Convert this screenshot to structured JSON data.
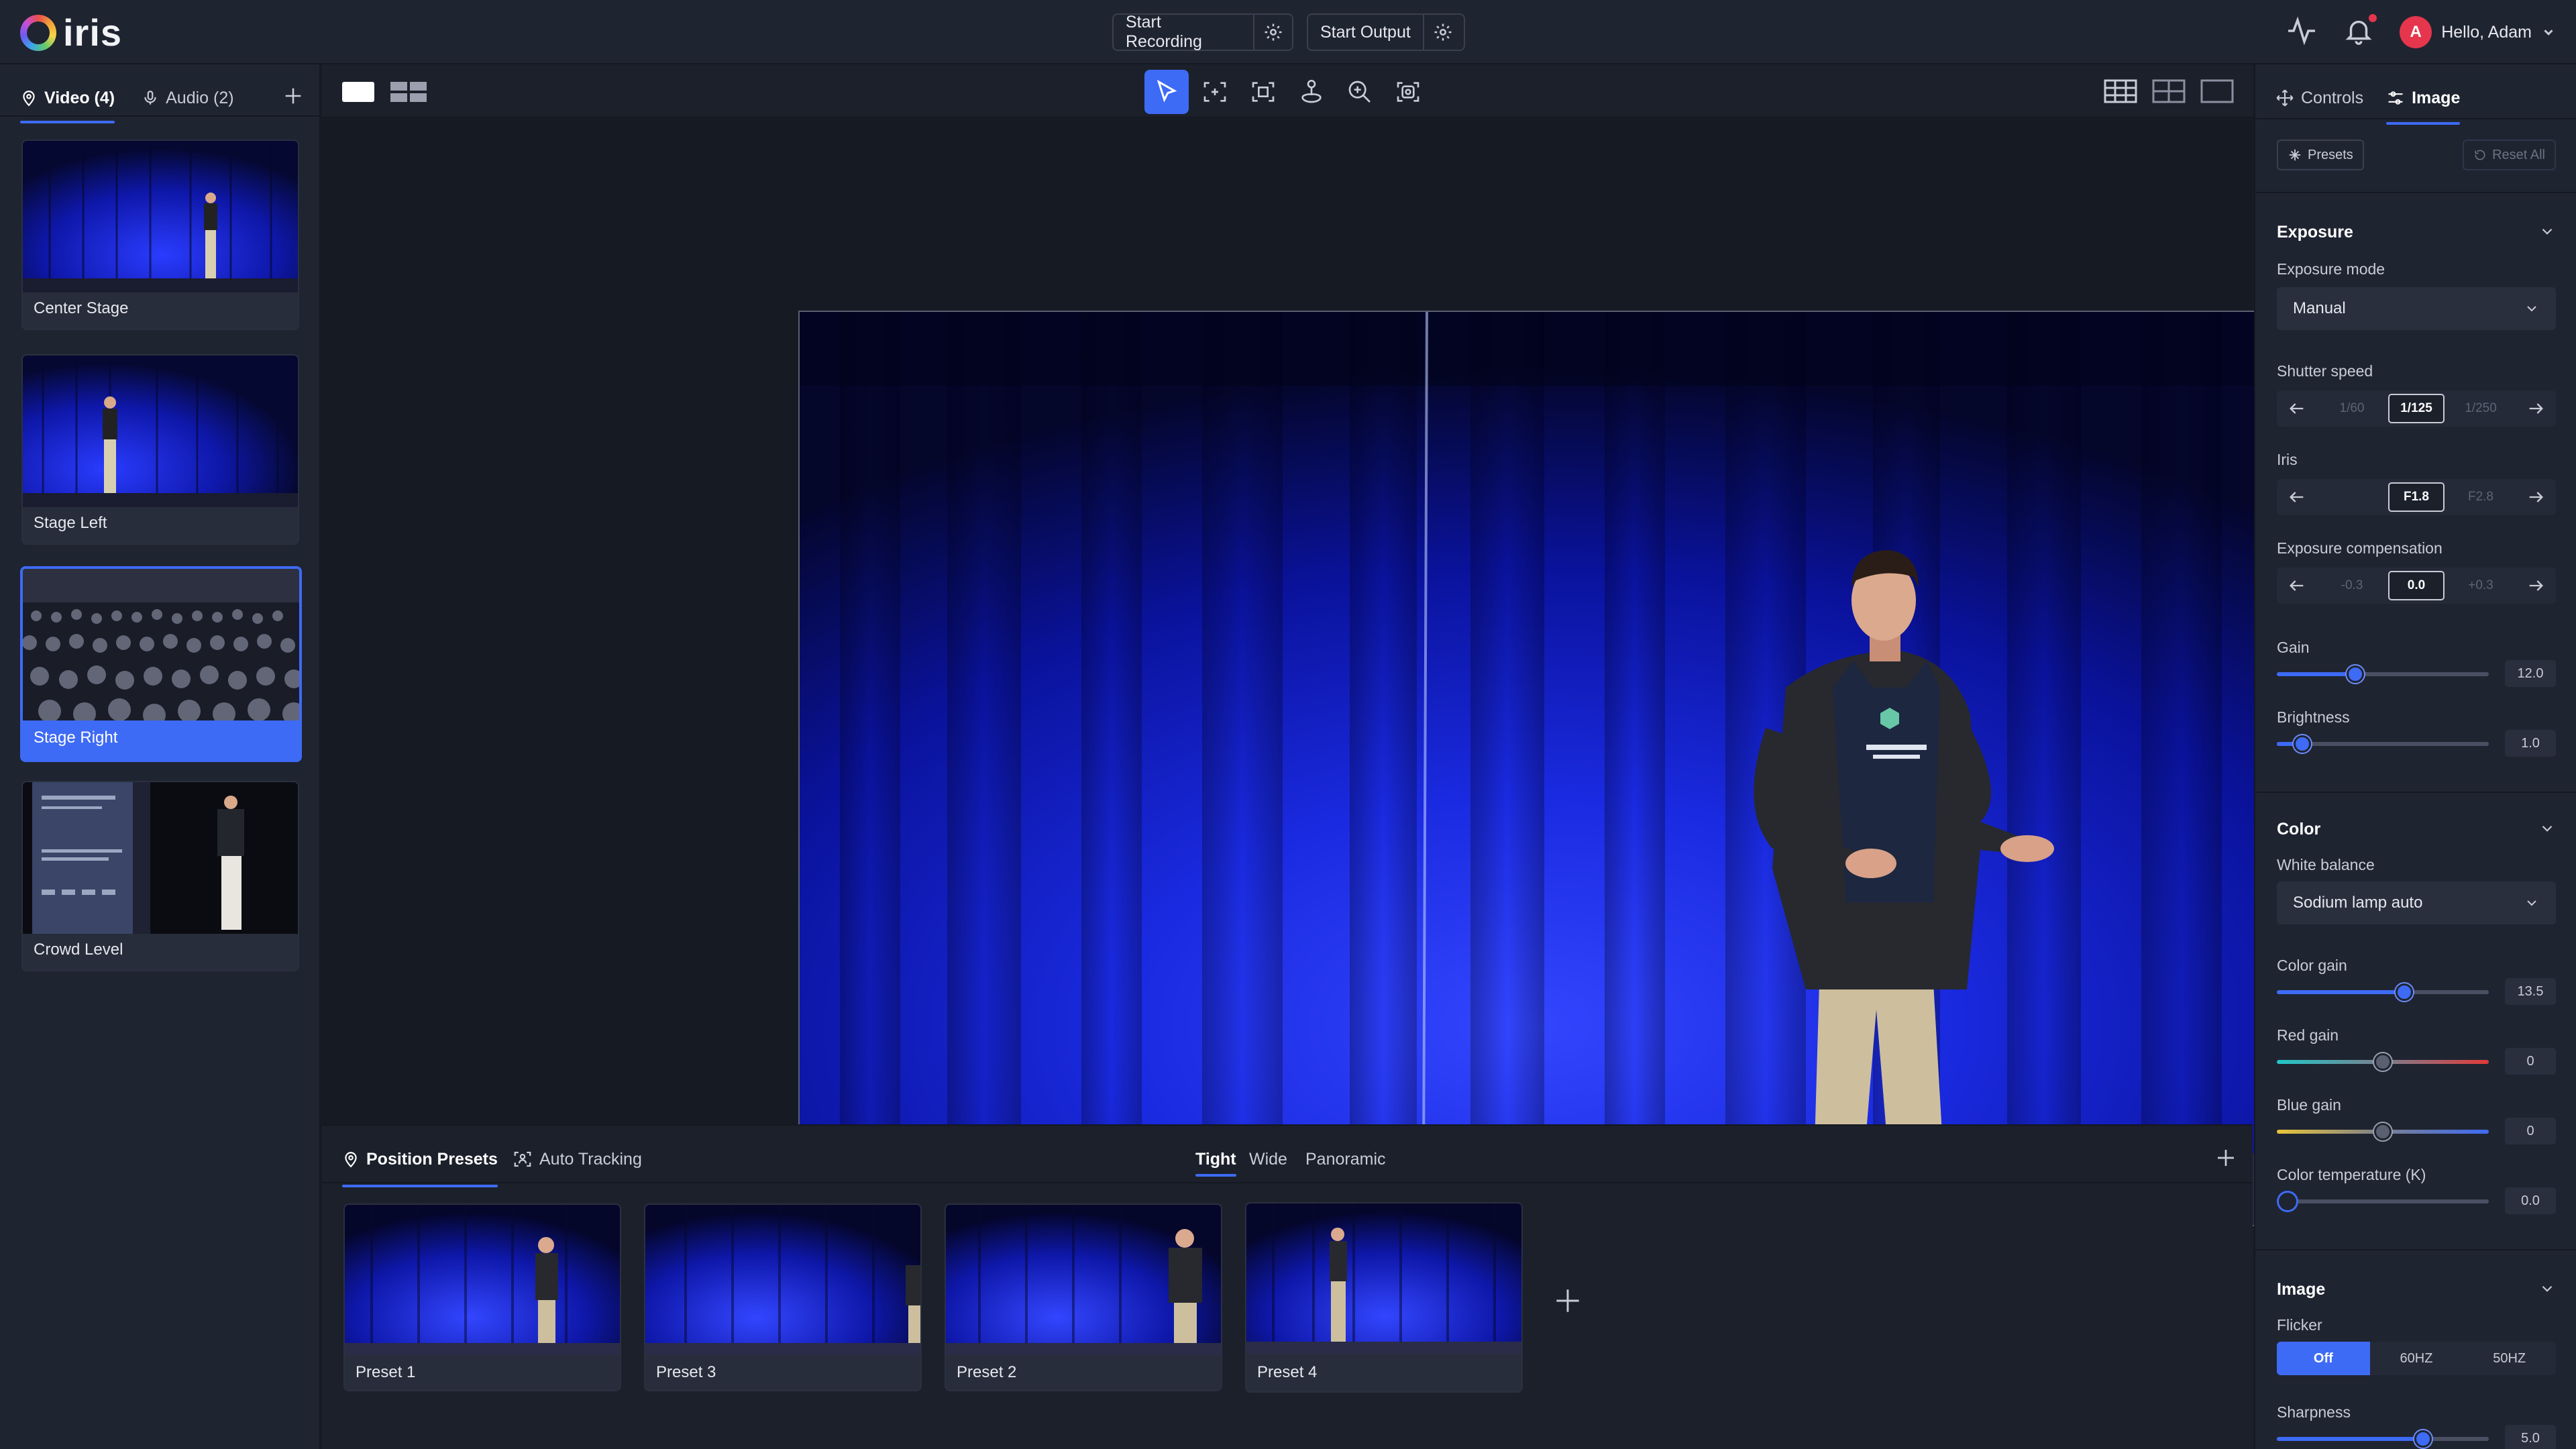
{
  "app": {
    "name": "iris"
  },
  "topbar": {
    "start_recording": "Start Recording",
    "start_output": "Start Output",
    "user_initial": "A",
    "greeting": "Hello, Adam"
  },
  "sources": {
    "tabs": [
      {
        "label": "Video (4)"
      },
      {
        "label": "Audio (2)"
      }
    ],
    "cameras": [
      {
        "label": "Center Stage"
      },
      {
        "label": "Stage Left"
      },
      {
        "label": "Stage Right"
      },
      {
        "label": "Crowd Level"
      }
    ],
    "active_camera": "Stage Right"
  },
  "presets_panel": {
    "tabs": [
      {
        "label": "Position Presets"
      },
      {
        "label": "Auto Tracking"
      }
    ],
    "framing": [
      "Tight",
      "Wide",
      "Panoramic"
    ],
    "active_framing": "Tight",
    "presets": [
      {
        "label": "Preset 1"
      },
      {
        "label": "Preset 3"
      },
      {
        "label": "Preset 2"
      },
      {
        "label": "Preset 4"
      }
    ]
  },
  "right_panel": {
    "tabs": [
      {
        "label": "Controls"
      },
      {
        "label": "Image"
      }
    ],
    "presets_btn": "Presets",
    "reset_btn": "Reset All",
    "exposure": {
      "title": "Exposure",
      "mode_label": "Exposure mode",
      "mode_value": "Manual",
      "shutter_label": "Shutter speed",
      "shutter_options": [
        "1/60",
        "1/125",
        "1/250"
      ],
      "shutter_selected": "1/125",
      "iris_label": "Iris",
      "iris_options": [
        "",
        "F1.8",
        "F2.8"
      ],
      "iris_selected": "F1.8",
      "comp_label": "Exposure compensation",
      "comp_options": [
        "-0.3",
        "0.0",
        "+0.3"
      ],
      "comp_selected": "0.0",
      "gain_label": "Gain",
      "gain_value": "12.0",
      "gain_level": 0.37,
      "brightness_label": "Brightness",
      "brightness_value": "1.0",
      "brightness_level": 0.12
    },
    "color": {
      "title": "Color",
      "wb_label": "White balance",
      "wb_value": "Sodium lamp auto",
      "color_gain_label": "Color gain",
      "color_gain_value": "13.5",
      "color_gain_level": 0.6,
      "red_gain_label": "Red gain",
      "red_gain_value": "0",
      "red_gain_level": 0.5,
      "blue_gain_label": "Blue gain",
      "blue_gain_value": "0",
      "blue_gain_level": 0.5,
      "temp_label": "Color temperature (K)",
      "temp_value": "0.0",
      "temp_level": 0.05
    },
    "image": {
      "title": "Image",
      "flicker_label": "Flicker",
      "flicker_options": [
        "Off",
        "60HZ",
        "50HZ"
      ],
      "flicker_selected": "Off",
      "sharpness_label": "Sharpness",
      "sharpness_value": "5.0",
      "sharpness_level": 0.69
    }
  },
  "colors": {
    "accent": "#3e6bf5",
    "panel": "#1f2431",
    "background": "#181c25"
  }
}
